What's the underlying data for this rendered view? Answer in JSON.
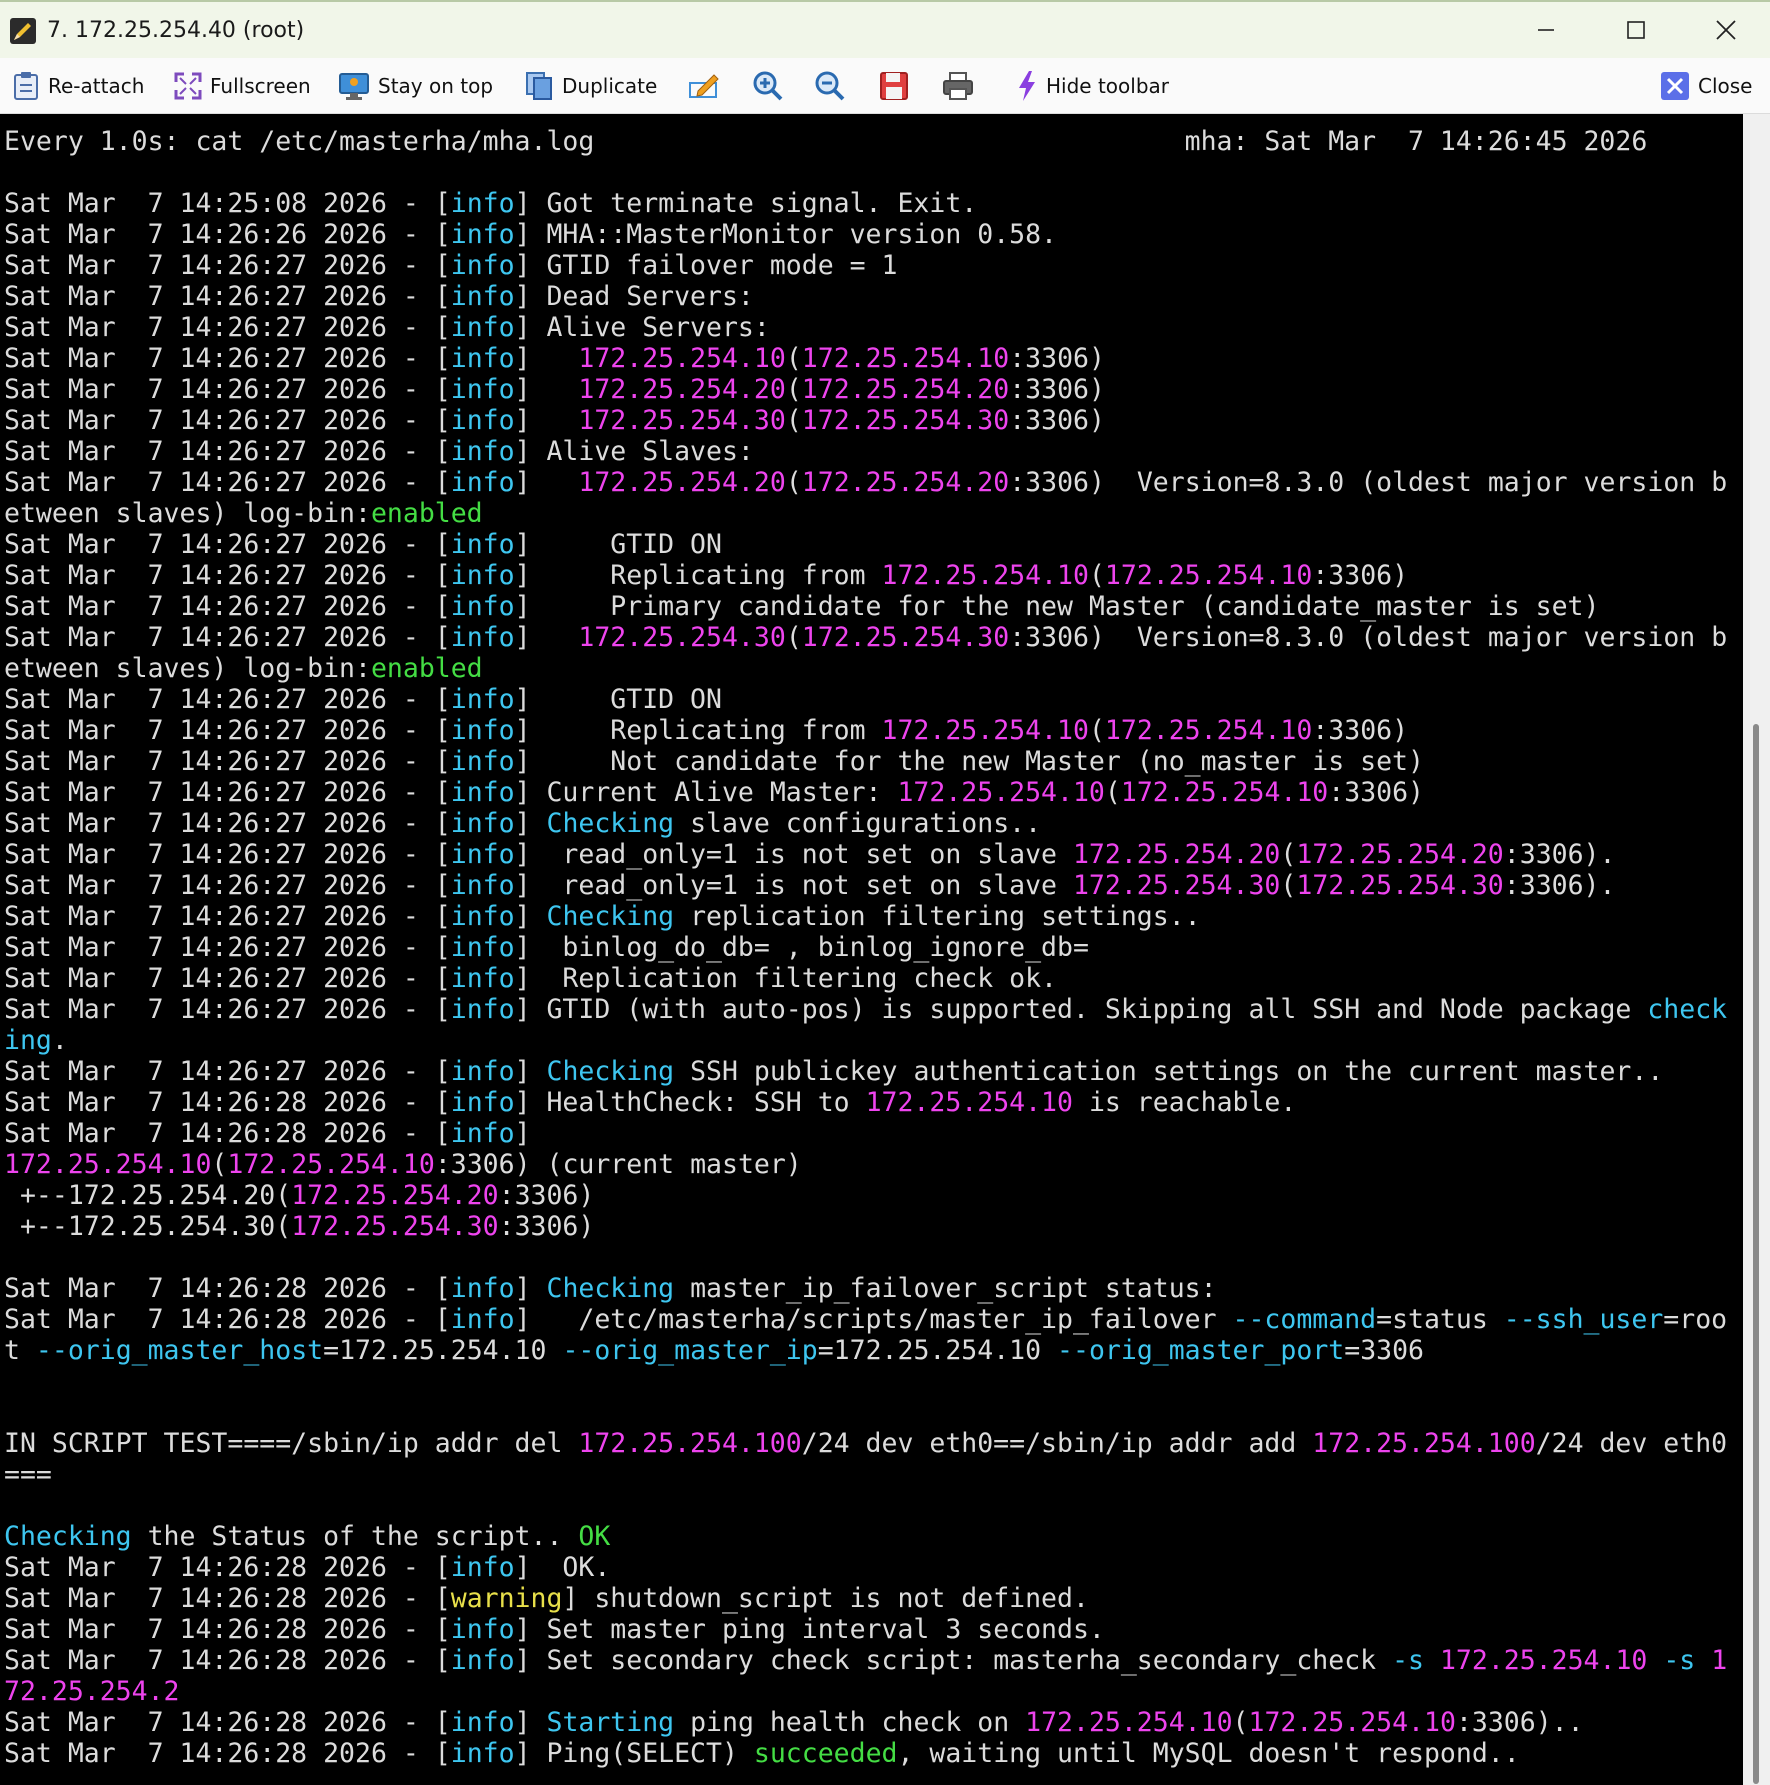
{
  "window": {
    "title": "7. 172.25.254.40 (root)",
    "minimize_glyph": "─",
    "maximize_glyph": "☐",
    "close_glyph": "✕"
  },
  "toolbar": {
    "reattach": "Re-attach",
    "fullscreen": "Fullscreen",
    "stay_on_top": "Stay on top",
    "duplicate": "Duplicate",
    "hide_toolbar": "Hide toolbar",
    "close": "Close"
  },
  "colors": {
    "ip": "#ee44ee",
    "info": "#3ec6f0",
    "warning": "#e8e04a",
    "enabled": "#44dd44",
    "text": "#dcdcdc",
    "background": "#000000"
  },
  "terminal": {
    "lines": [
      [
        {
          "t": "Every 1.0s: cat /etc/masterha/mha.log                                     mha: Sat Mar  7 14:26:45 2026"
        }
      ],
      [
        {
          "t": ""
        }
      ],
      [
        {
          "t": "Sat Mar  7 14:25:08 2026 - ["
        },
        {
          "t": "info",
          "c": "info"
        },
        {
          "t": "] Got terminate signal. Exit."
        }
      ],
      [
        {
          "t": "Sat Mar  7 14:26:26 2026 - ["
        },
        {
          "t": "info",
          "c": "info"
        },
        {
          "t": "] MHA::MasterMonitor version 0.58."
        }
      ],
      [
        {
          "t": "Sat Mar  7 14:26:27 2026 - ["
        },
        {
          "t": "info",
          "c": "info"
        },
        {
          "t": "] GTID failover mode = 1"
        }
      ],
      [
        {
          "t": "Sat Mar  7 14:26:27 2026 - ["
        },
        {
          "t": "info",
          "c": "info"
        },
        {
          "t": "] Dead Servers:"
        }
      ],
      [
        {
          "t": "Sat Mar  7 14:26:27 2026 - ["
        },
        {
          "t": "info",
          "c": "info"
        },
        {
          "t": "] Alive Servers:"
        }
      ],
      [
        {
          "t": "Sat Mar  7 14:26:27 2026 - ["
        },
        {
          "t": "info",
          "c": "info"
        },
        {
          "t": "]   "
        },
        {
          "t": "172.25.254.10",
          "c": "ip"
        },
        {
          "t": "("
        },
        {
          "t": "172.25.254.10",
          "c": "ip"
        },
        {
          "t": ":3306)"
        }
      ],
      [
        {
          "t": "Sat Mar  7 14:26:27 2026 - ["
        },
        {
          "t": "info",
          "c": "info"
        },
        {
          "t": "]   "
        },
        {
          "t": "172.25.254.20",
          "c": "ip"
        },
        {
          "t": "("
        },
        {
          "t": "172.25.254.20",
          "c": "ip"
        },
        {
          "t": ":3306)"
        }
      ],
      [
        {
          "t": "Sat Mar  7 14:26:27 2026 - ["
        },
        {
          "t": "info",
          "c": "info"
        },
        {
          "t": "]   "
        },
        {
          "t": "172.25.254.30",
          "c": "ip"
        },
        {
          "t": "("
        },
        {
          "t": "172.25.254.30",
          "c": "ip"
        },
        {
          "t": ":3306)"
        }
      ],
      [
        {
          "t": "Sat Mar  7 14:26:27 2026 - ["
        },
        {
          "t": "info",
          "c": "info"
        },
        {
          "t": "] Alive Slaves:"
        }
      ],
      [
        {
          "t": "Sat Mar  7 14:26:27 2026 - ["
        },
        {
          "t": "info",
          "c": "info"
        },
        {
          "t": "]   "
        },
        {
          "t": "172.25.254.20",
          "c": "ip"
        },
        {
          "t": "("
        },
        {
          "t": "172.25.254.20",
          "c": "ip"
        },
        {
          "t": ":3306)  Version=8.3.0 (oldest major version b"
        }
      ],
      [
        {
          "t": "etween slaves) log-bin:"
        },
        {
          "t": "enabled",
          "c": "green"
        }
      ],
      [
        {
          "t": "Sat Mar  7 14:26:27 2026 - ["
        },
        {
          "t": "info",
          "c": "info"
        },
        {
          "t": "]     GTID ON"
        }
      ],
      [
        {
          "t": "Sat Mar  7 14:26:27 2026 - ["
        },
        {
          "t": "info",
          "c": "info"
        },
        {
          "t": "]     Replicating from "
        },
        {
          "t": "172.25.254.10",
          "c": "ip"
        },
        {
          "t": "("
        },
        {
          "t": "172.25.254.10",
          "c": "ip"
        },
        {
          "t": ":3306)"
        }
      ],
      [
        {
          "t": "Sat Mar  7 14:26:27 2026 - ["
        },
        {
          "t": "info",
          "c": "info"
        },
        {
          "t": "]     Primary candidate for the new Master (candidate_master is set)"
        }
      ],
      [
        {
          "t": "Sat Mar  7 14:26:27 2026 - ["
        },
        {
          "t": "info",
          "c": "info"
        },
        {
          "t": "]   "
        },
        {
          "t": "172.25.254.30",
          "c": "ip"
        },
        {
          "t": "("
        },
        {
          "t": "172.25.254.30",
          "c": "ip"
        },
        {
          "t": ":3306)  Version=8.3.0 (oldest major version b"
        }
      ],
      [
        {
          "t": "etween slaves) log-bin:"
        },
        {
          "t": "enabled",
          "c": "green"
        }
      ],
      [
        {
          "t": "Sat Mar  7 14:26:27 2026 - ["
        },
        {
          "t": "info",
          "c": "info"
        },
        {
          "t": "]     GTID ON"
        }
      ],
      [
        {
          "t": "Sat Mar  7 14:26:27 2026 - ["
        },
        {
          "t": "info",
          "c": "info"
        },
        {
          "t": "]     Replicating from "
        },
        {
          "t": "172.25.254.10",
          "c": "ip"
        },
        {
          "t": "("
        },
        {
          "t": "172.25.254.10",
          "c": "ip"
        },
        {
          "t": ":3306)"
        }
      ],
      [
        {
          "t": "Sat Mar  7 14:26:27 2026 - ["
        },
        {
          "t": "info",
          "c": "info"
        },
        {
          "t": "]     Not candidate for the new Master (no_master is set)"
        }
      ],
      [
        {
          "t": "Sat Mar  7 14:26:27 2026 - ["
        },
        {
          "t": "info",
          "c": "info"
        },
        {
          "t": "] Current Alive Master: "
        },
        {
          "t": "172.25.254.10",
          "c": "ip"
        },
        {
          "t": "("
        },
        {
          "t": "172.25.254.10",
          "c": "ip"
        },
        {
          "t": ":3306)"
        }
      ],
      [
        {
          "t": "Sat Mar  7 14:26:27 2026 - ["
        },
        {
          "t": "info",
          "c": "info"
        },
        {
          "t": "] "
        },
        {
          "t": "Checking",
          "c": "check"
        },
        {
          "t": " slave configurations.."
        }
      ],
      [
        {
          "t": "Sat Mar  7 14:26:27 2026 - ["
        },
        {
          "t": "info",
          "c": "info"
        },
        {
          "t": "]  read_only=1 is not set on slave "
        },
        {
          "t": "172.25.254.20",
          "c": "ip"
        },
        {
          "t": "("
        },
        {
          "t": "172.25.254.20",
          "c": "ip"
        },
        {
          "t": ":3306)."
        }
      ],
      [
        {
          "t": "Sat Mar  7 14:26:27 2026 - ["
        },
        {
          "t": "info",
          "c": "info"
        },
        {
          "t": "]  read_only=1 is not set on slave "
        },
        {
          "t": "172.25.254.30",
          "c": "ip"
        },
        {
          "t": "("
        },
        {
          "t": "172.25.254.30",
          "c": "ip"
        },
        {
          "t": ":3306)."
        }
      ],
      [
        {
          "t": "Sat Mar  7 14:26:27 2026 - ["
        },
        {
          "t": "info",
          "c": "info"
        },
        {
          "t": "] "
        },
        {
          "t": "Checking",
          "c": "check"
        },
        {
          "t": " replication filtering settings.."
        }
      ],
      [
        {
          "t": "Sat Mar  7 14:26:27 2026 - ["
        },
        {
          "t": "info",
          "c": "info"
        },
        {
          "t": "]  binlog_do_db= , binlog_ignore_db="
        }
      ],
      [
        {
          "t": "Sat Mar  7 14:26:27 2026 - ["
        },
        {
          "t": "info",
          "c": "info"
        },
        {
          "t": "]  Replication filtering check ok."
        }
      ],
      [
        {
          "t": "Sat Mar  7 14:26:27 2026 - ["
        },
        {
          "t": "info",
          "c": "info"
        },
        {
          "t": "] GTID (with auto-pos) is supported. Skipping all SSH and Node package "
        },
        {
          "t": "check",
          "c": "check"
        }
      ],
      [
        {
          "t": "ing",
          "c": "check"
        },
        {
          "t": "."
        }
      ],
      [
        {
          "t": "Sat Mar  7 14:26:27 2026 - ["
        },
        {
          "t": "info",
          "c": "info"
        },
        {
          "t": "] "
        },
        {
          "t": "Checking",
          "c": "check"
        },
        {
          "t": " SSH publickey authentication settings on the current master.."
        }
      ],
      [
        {
          "t": "Sat Mar  7 14:26:28 2026 - ["
        },
        {
          "t": "info",
          "c": "info"
        },
        {
          "t": "] HealthCheck: SSH to "
        },
        {
          "t": "172.25.254.10",
          "c": "ip"
        },
        {
          "t": " is reachable."
        }
      ],
      [
        {
          "t": "Sat Mar  7 14:26:28 2026 - ["
        },
        {
          "t": "info",
          "c": "info"
        },
        {
          "t": "]"
        }
      ],
      [
        {
          "t": "172.25.254.10",
          "c": "ip"
        },
        {
          "t": "("
        },
        {
          "t": "172.25.254.10",
          "c": "ip"
        },
        {
          "t": ":3306) (current master)"
        }
      ],
      [
        {
          "t": " +--172.25.254.20("
        },
        {
          "t": "172.25.254.20",
          "c": "ip"
        },
        {
          "t": ":3306)"
        }
      ],
      [
        {
          "t": " +--172.25.254.30("
        },
        {
          "t": "172.25.254.30",
          "c": "ip"
        },
        {
          "t": ":3306)"
        }
      ],
      [
        {
          "t": ""
        }
      ],
      [
        {
          "t": "Sat Mar  7 14:26:28 2026 - ["
        },
        {
          "t": "info",
          "c": "info"
        },
        {
          "t": "] "
        },
        {
          "t": "Checking",
          "c": "check"
        },
        {
          "t": " master_ip_failover_script status:"
        }
      ],
      [
        {
          "t": "Sat Mar  7 14:26:28 2026 - ["
        },
        {
          "t": "info",
          "c": "info"
        },
        {
          "t": "]   /etc/masterha/scripts/master_ip_failover "
        },
        {
          "t": "--command",
          "c": "check"
        },
        {
          "t": "=status "
        },
        {
          "t": "--ssh_user",
          "c": "check"
        },
        {
          "t": "=roo"
        }
      ],
      [
        {
          "t": "t "
        },
        {
          "t": "--orig_master_host",
          "c": "check"
        },
        {
          "t": "=172.25.254.10 "
        },
        {
          "t": "--orig_master_ip",
          "c": "check"
        },
        {
          "t": "=172.25.254.10 "
        },
        {
          "t": "--orig_master_port",
          "c": "check"
        },
        {
          "t": "=3306"
        }
      ],
      [
        {
          "t": ""
        }
      ],
      [
        {
          "t": ""
        }
      ],
      [
        {
          "t": "IN SCRIPT TEST====/sbin/ip addr del "
        },
        {
          "t": "172.25.254.100",
          "c": "ip"
        },
        {
          "t": "/24 dev eth0==/sbin/ip addr add "
        },
        {
          "t": "172.25.254.100",
          "c": "ip"
        },
        {
          "t": "/24 dev eth0"
        }
      ],
      [
        {
          "t": "==="
        }
      ],
      [
        {
          "t": ""
        }
      ],
      [
        {
          "t": "Checking",
          "c": "check"
        },
        {
          "t": " the Status of the script.. "
        },
        {
          "t": "OK",
          "c": "green"
        }
      ],
      [
        {
          "t": "Sat Mar  7 14:26:28 2026 - ["
        },
        {
          "t": "info",
          "c": "info"
        },
        {
          "t": "]  OK."
        }
      ],
      [
        {
          "t": "Sat Mar  7 14:26:28 2026 - ["
        },
        {
          "t": "warning",
          "c": "warn"
        },
        {
          "t": "] shutdown_script is not defined."
        }
      ],
      [
        {
          "t": "Sat Mar  7 14:26:28 2026 - ["
        },
        {
          "t": "info",
          "c": "info"
        },
        {
          "t": "] Set master ping interval 3 seconds."
        }
      ],
      [
        {
          "t": "Sat Mar  7 14:26:28 2026 - ["
        },
        {
          "t": "info",
          "c": "info"
        },
        {
          "t": "] Set secondary check script: masterha_secondary_check "
        },
        {
          "t": "-s",
          "c": "check"
        },
        {
          "t": " "
        },
        {
          "t": "172.25.254.10",
          "c": "ip"
        },
        {
          "t": " "
        },
        {
          "t": "-s",
          "c": "check"
        },
        {
          "t": " "
        },
        {
          "t": "1",
          "c": "ip"
        }
      ],
      [
        {
          "t": "72.25.254.2",
          "c": "ip"
        }
      ],
      [
        {
          "t": "Sat Mar  7 14:26:28 2026 - ["
        },
        {
          "t": "info",
          "c": "info"
        },
        {
          "t": "] "
        },
        {
          "t": "Starting",
          "c": "check"
        },
        {
          "t": " ping health check on "
        },
        {
          "t": "172.25.254.10",
          "c": "ip"
        },
        {
          "t": "("
        },
        {
          "t": "172.25.254.10",
          "c": "ip"
        },
        {
          "t": ":3306).."
        }
      ],
      [
        {
          "t": "Sat Mar  7 14:26:28 2026 - ["
        },
        {
          "t": "info",
          "c": "info"
        },
        {
          "t": "] Ping(SELECT) "
        },
        {
          "t": "succeeded",
          "c": "green"
        },
        {
          "t": ", waiting until MySQL doesn't respond.."
        }
      ]
    ]
  }
}
